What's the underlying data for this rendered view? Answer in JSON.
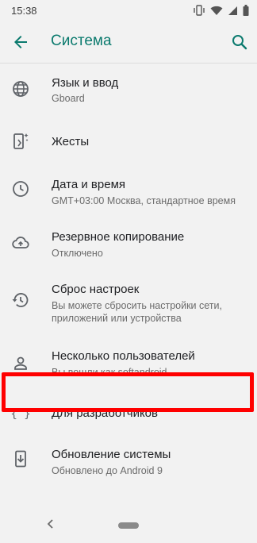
{
  "status_bar": {
    "time": "15:38"
  },
  "app_bar": {
    "title": "Система"
  },
  "items": [
    {
      "label": "Язык и ввод",
      "sub": "Gboard",
      "icon": "globe-icon"
    },
    {
      "label": "Жесты",
      "sub": "",
      "icon": "gestures-phone-icon"
    },
    {
      "label": "Дата и время",
      "sub": "GMT+03:00 Москва, стандартное время",
      "icon": "clock-icon"
    },
    {
      "label": "Резервное копирование",
      "sub": "Отключено",
      "icon": "cloud-upload-icon"
    },
    {
      "label": "Сброс настроек",
      "sub_lines": [
        "Вы можете сбросить настройки сети,",
        "приложений или устройства"
      ],
      "icon": "history-icon"
    },
    {
      "label": "Несколько пользователей",
      "sub": "Вы вошли как softandroid",
      "icon": "person-icon"
    },
    {
      "label": "Для разработчиков",
      "sub": "",
      "icon": "braces-icon"
    },
    {
      "label": "Обновление системы",
      "sub": "Обновлено до Android 9",
      "icon": "system-update-icon"
    }
  ],
  "colors": {
    "accent": "#0b7a6e",
    "highlight": "#ff0000",
    "background": "#f2f2f2"
  }
}
